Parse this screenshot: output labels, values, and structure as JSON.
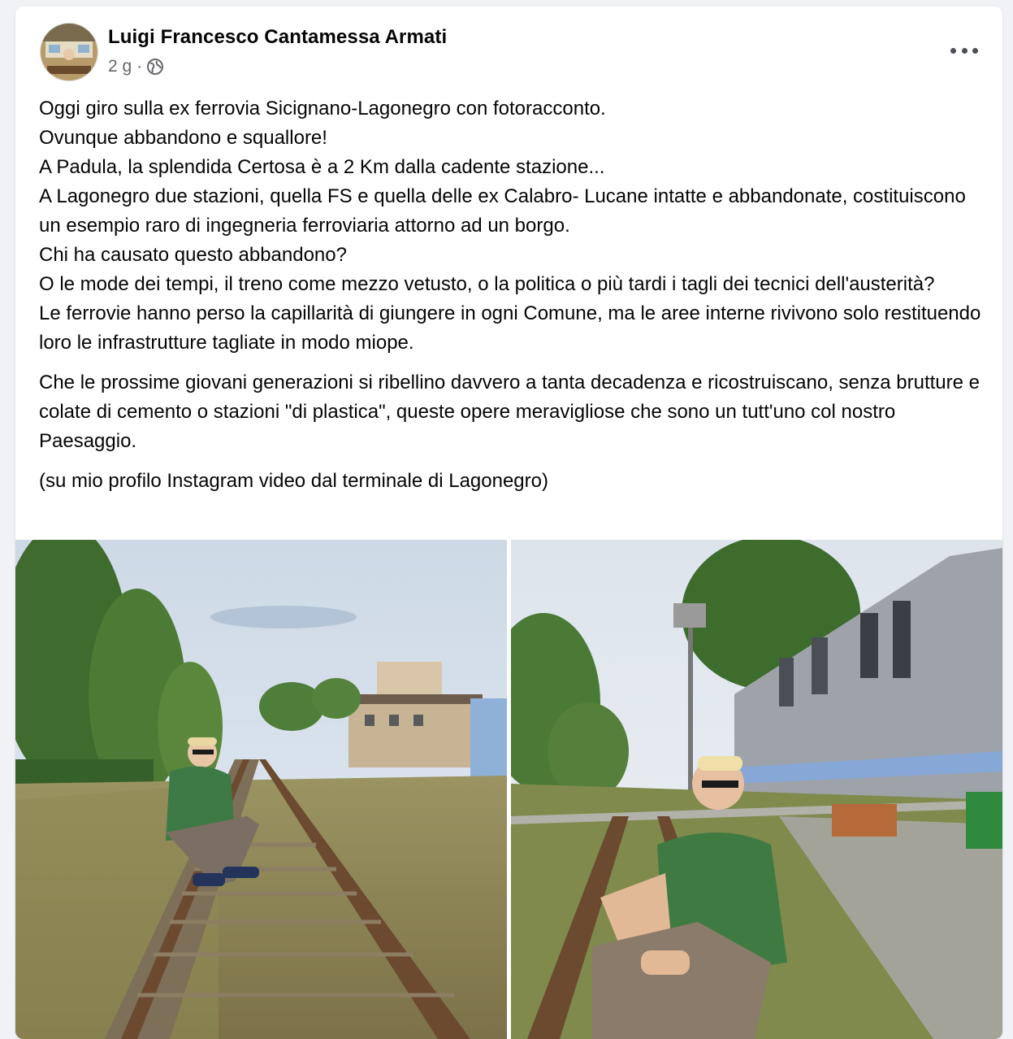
{
  "post": {
    "author": "Luigi Francesco Cantamessa Armati",
    "time": "2 g",
    "separator": "·",
    "audience_icon": "globe-icon",
    "more_icon": "more-options-icon",
    "paragraphs": [
      "Oggi giro sulla ex ferrovia Sicignano-Lagonegro con fotoracconto.",
      "Ovunque abbandono e squallore!",
      "A Padula, la splendida Certosa è a 2 Km dalla cadente stazione...",
      "A Lagonegro due stazioni, quella FS e quella delle ex Calabro- Lucane intatte e abbandonate, costituiscono un esempio raro di ingegneria ferroviaria attorno ad un borgo.",
      "Chi ha causato questo abbandono?",
      "O le mode dei tempi, il treno come mezzo vetusto, o la politica o più tardi i tagli dei tecnici dell'austerità?",
      "Le ferrovie hanno perso la capillarità di giungere in ogni Comune, ma le aree interne rivivono solo restituendo loro le  infrastrutture tagliate in modo miope.",
      "Che le prossime giovani generazioni si ribellino davvero a tanta decadenza e ricostruiscano, senza brutture e colate di cemento o stazioni \"di plastica\", queste opere  meravigliose che sono  un tutt'uno col nostro Paesaggio.",
      "(su mio profilo Instagram video dal terminale di Lagonegro)"
    ]
  },
  "colors": {
    "text": "#050505",
    "secondary": "#65676b",
    "background": "#f0f2f5",
    "card": "#ffffff"
  }
}
